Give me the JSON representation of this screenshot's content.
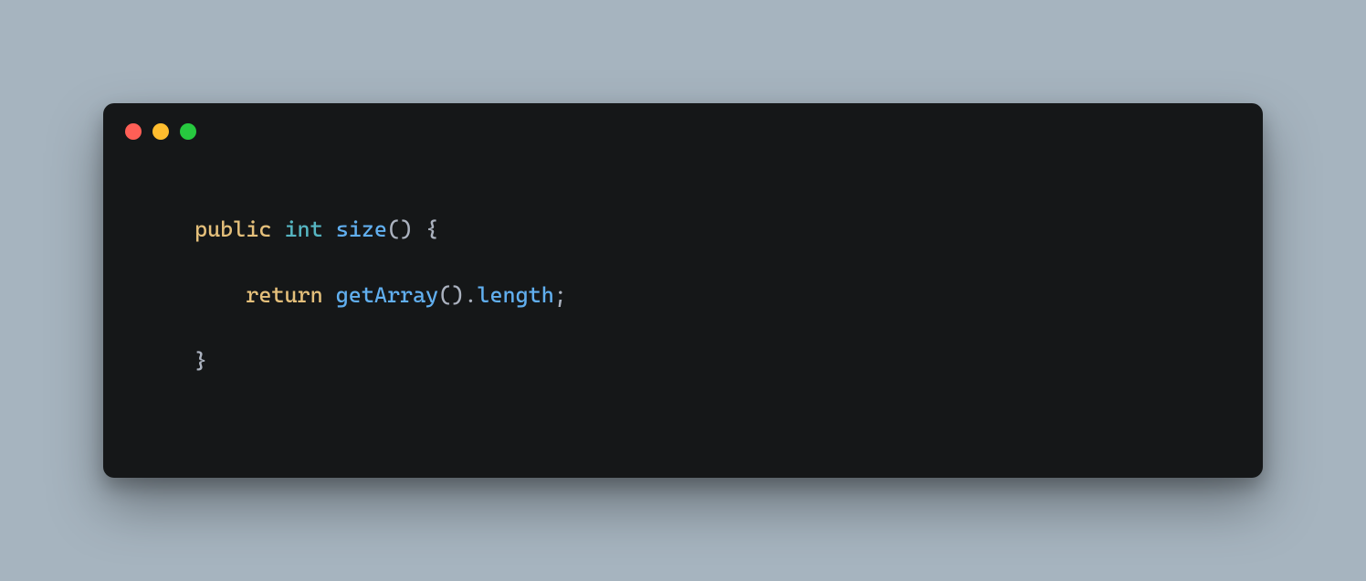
{
  "window": {
    "traffic_lights": {
      "red": "#ff5f56",
      "yellow": "#ffbd2e",
      "green": "#27c93f"
    }
  },
  "code": {
    "line1": {
      "keyword_public": "public",
      "type_int": "int",
      "func_size": "size",
      "parens_brace": "() {"
    },
    "line2": {
      "keyword_return": "return",
      "func_getArray": "getArray",
      "parens": "()",
      "dot": ".",
      "prop_length": "length",
      "semi": ";"
    },
    "line3": {
      "close_brace": "}"
    }
  }
}
